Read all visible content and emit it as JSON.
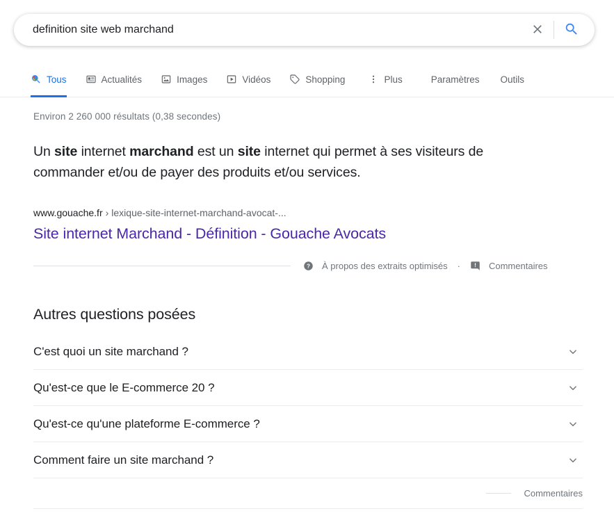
{
  "search": {
    "query": "definition site web marchand",
    "placeholder": "Rechercher",
    "clear_label": "Effacer",
    "submit_label": "Recherche Google"
  },
  "tabs": [
    {
      "label": "Tous",
      "icon": "search-icon",
      "active": true
    },
    {
      "label": "Actualités",
      "icon": "news-icon",
      "active": false
    },
    {
      "label": "Images",
      "icon": "image-icon",
      "active": false
    },
    {
      "label": "Vidéos",
      "icon": "video-icon",
      "active": false
    },
    {
      "label": "Shopping",
      "icon": "tag-icon",
      "active": false
    },
    {
      "label": "Plus",
      "icon": "more-vertical-icon",
      "active": false
    }
  ],
  "tab_actions": [
    {
      "label": "Paramètres"
    },
    {
      "label": "Outils"
    }
  ],
  "results": {
    "stats": "Environ 2 260 000 résultats (0,38 secondes)",
    "snippet": {
      "part1": "Un ",
      "bold1": "site",
      "part2": " internet ",
      "bold2": "marchand",
      "part3": " est un ",
      "bold3": "site",
      "part4": " internet qui permet à ses visiteurs de commander et/ou de payer des produits et/ou services.",
      "url_domain": "www.gouache.fr",
      "url_separator": "›",
      "url_path": "lexique-site-internet-marchand-avocat-...",
      "title": "Site internet Marchand - Définition - Gouache Avocats",
      "about_link": "À propos des extraits optimisés",
      "separator": "·",
      "feedback_link": "Commentaires"
    }
  },
  "people_also_ask": {
    "heading": "Autres questions posées",
    "questions": [
      {
        "text": "C'est quoi un site marchand ?"
      },
      {
        "text": "Qu'est-ce que le E-commerce 20 ?"
      },
      {
        "text": "Qu'est-ce qu'une plateforme E-commerce ?"
      },
      {
        "text": "Comment faire un site marchand ?"
      }
    ],
    "feedback_link": "Commentaires"
  },
  "colors": {
    "accent_blue": "#1a73e8",
    "visited_purple": "#4a27a8",
    "text_gray": "#70757a",
    "text_dark": "#202124",
    "google_blue": "#4285f4",
    "google_red": "#ea4335",
    "google_yellow": "#fbbc05",
    "google_green": "#34a853"
  }
}
